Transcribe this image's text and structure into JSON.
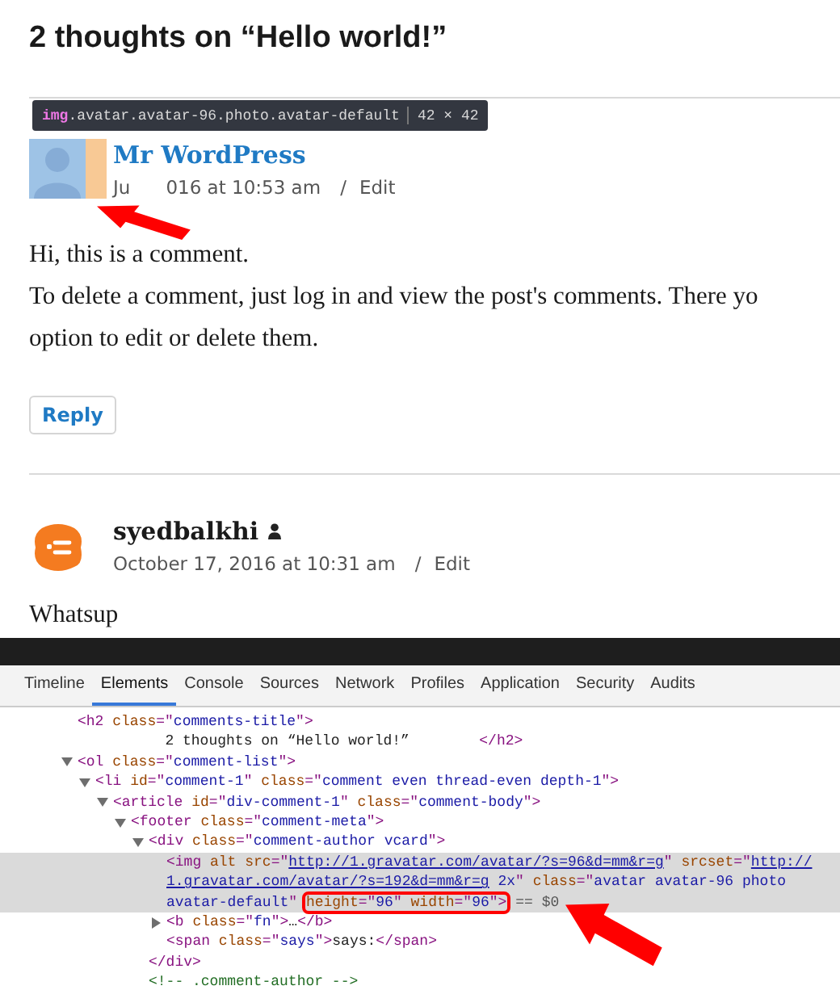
{
  "heading": "2 thoughts on “Hello world!”",
  "inspector_tooltip": {
    "tag": "img",
    "classes": ".avatar.avatar-96.photo.avatar-default",
    "size": "42 × 42"
  },
  "comments": [
    {
      "author": "Mr WordPress",
      "post_author": false,
      "avatar": {
        "kind": "default"
      },
      "date_parts": [
        "Ju",
        "016 at 10:53 am"
      ],
      "separator": "/",
      "edit": "Edit",
      "body": [
        "Hi, this is a comment.",
        "To delete a comment, just log in and view the post's comments. There yo",
        "option to edit or delete them."
      ],
      "reply": "Reply",
      "annotated": true
    },
    {
      "author": "syedbalkhi",
      "post_author": true,
      "avatar": {
        "kind": "logo"
      },
      "date_parts": [
        "October 17, 2016 at 10:31 am"
      ],
      "separator": "/",
      "edit": "Edit",
      "body": [
        "Whatsup"
      ],
      "annotated": false
    }
  ],
  "devtools": {
    "tabs": [
      {
        "label": "Timeline",
        "selected": false
      },
      {
        "label": "Elements",
        "selected": true
      },
      {
        "label": "Console",
        "selected": false
      },
      {
        "label": "Sources",
        "selected": false
      },
      {
        "label": "Network",
        "selected": false
      },
      {
        "label": "Profiles",
        "selected": false
      },
      {
        "label": "Application",
        "selected": false
      },
      {
        "label": "Security",
        "selected": false
      },
      {
        "label": "Audits",
        "selected": false
      }
    ],
    "nodes": [
      {
        "selected": false,
        "lines": [
          [
            {
              "kind": "tag",
              "text": "<h2"
            },
            {
              "kind": "attr",
              "text": " class"
            },
            {
              "kind": "tag",
              "text": "=\""
            },
            {
              "kind": "value",
              "text": "comments-title"
            },
            {
              "kind": "tag",
              "text": "\">"
            }
          ]
        ],
        "children": [
          {
            "selected": false,
            "lines": [
              [
                {
                  "kind": "plain",
                  "text": "        2 thoughts on “Hello world!”        "
                },
                {
                  "kind": "tag",
                  "text": "</h2>"
                }
              ]
            ]
          }
        ]
      },
      {
        "selected": false,
        "expanded": true,
        "lines": [
          [
            {
              "kind": "tag",
              "text": "<ol"
            },
            {
              "kind": "attr",
              "text": " class"
            },
            {
              "kind": "tag",
              "text": "=\""
            },
            {
              "kind": "value",
              "text": "comment-list"
            },
            {
              "kind": "tag",
              "text": "\">"
            }
          ]
        ],
        "children": [
          {
            "selected": false,
            "expanded": true,
            "lines": [
              [
                {
                  "kind": "tag",
                  "text": "<li"
                },
                {
                  "kind": "attr",
                  "text": " id"
                },
                {
                  "kind": "tag",
                  "text": "=\""
                },
                {
                  "kind": "value",
                  "text": "comment-1"
                },
                {
                  "kind": "tag",
                  "text": "\""
                },
                {
                  "kind": "attr",
                  "text": " class"
                },
                {
                  "kind": "tag",
                  "text": "=\""
                },
                {
                  "kind": "value",
                  "text": "comment even thread-even depth-1"
                },
                {
                  "kind": "tag",
                  "text": "\">"
                }
              ]
            ],
            "children": [
              {
                "selected": false,
                "expanded": true,
                "lines": [
                  [
                    {
                      "kind": "tag",
                      "text": "<article"
                    },
                    {
                      "kind": "attr",
                      "text": " id"
                    },
                    {
                      "kind": "tag",
                      "text": "=\""
                    },
                    {
                      "kind": "value",
                      "text": "div-comment-1"
                    },
                    {
                      "kind": "tag",
                      "text": "\""
                    },
                    {
                      "kind": "attr",
                      "text": " class"
                    },
                    {
                      "kind": "tag",
                      "text": "=\""
                    },
                    {
                      "kind": "value",
                      "text": "comment-body"
                    },
                    {
                      "kind": "tag",
                      "text": "\">"
                    }
                  ]
                ],
                "children": [
                  {
                    "selected": false,
                    "expanded": true,
                    "lines": [
                      [
                        {
                          "kind": "tag",
                          "text": "<footer"
                        },
                        {
                          "kind": "attr",
                          "text": " class"
                        },
                        {
                          "kind": "tag",
                          "text": "=\""
                        },
                        {
                          "kind": "value",
                          "text": "comment-meta"
                        },
                        {
                          "kind": "tag",
                          "text": "\">"
                        }
                      ]
                    ],
                    "children": [
                      {
                        "selected": false,
                        "expanded": true,
                        "lines": [
                          [
                            {
                              "kind": "tag",
                              "text": "<div"
                            },
                            {
                              "kind": "attr",
                              "text": " class"
                            },
                            {
                              "kind": "tag",
                              "text": "=\""
                            },
                            {
                              "kind": "value",
                              "text": "comment-author vcard"
                            },
                            {
                              "kind": "tag",
                              "text": "\">"
                            }
                          ]
                        ],
                        "close": [
                          {
                            "kind": "tag",
                            "text": "</div>"
                          }
                        ],
                        "children": [
                          {
                            "selected": true,
                            "lines": [
                              [
                                {
                                  "kind": "tag",
                                  "text": "<img"
                                },
                                {
                                  "kind": "attr",
                                  "text": " alt src"
                                },
                                {
                                  "kind": "tag",
                                  "text": "=\""
                                },
                                {
                                  "kind": "link",
                                  "text": "http://1.gravatar.com/avatar/?s=96&d=mm&r=g"
                                },
                                {
                                  "kind": "tag",
                                  "text": "\""
                                },
                                {
                                  "kind": "attr",
                                  "text": " srcset"
                                },
                                {
                                  "kind": "tag",
                                  "text": "=\""
                                },
                                {
                                  "kind": "link",
                                  "text": "http://"
                                }
                              ],
                              [
                                {
                                  "kind": "link",
                                  "text": "1.gravatar.com/avatar/?s=192&d=mm&r=g"
                                },
                                {
                                  "kind": "value",
                                  "text": " 2x"
                                },
                                {
                                  "kind": "tag",
                                  "text": "\""
                                },
                                {
                                  "kind": "attr",
                                  "text": " class"
                                },
                                {
                                  "kind": "tag",
                                  "text": "=\""
                                },
                                {
                                  "kind": "value",
                                  "text": "avatar avatar-96 photo"
                                }
                              ],
                              [
                                {
                                  "kind": "value",
                                  "text": "avatar-default"
                                },
                                {
                                  "kind": "tag",
                                  "text": "\" "
                                },
                                {
                                  "kind": "box",
                                  "tokens": [
                                    {
                                      "kind": "attr",
                                      "text": "height"
                                    },
                                    {
                                      "kind": "tag",
                                      "text": "=\""
                                    },
                                    {
                                      "kind": "value",
                                      "text": "96"
                                    },
                                    {
                                      "kind": "tag",
                                      "text": "\""
                                    },
                                    {
                                      "kind": "attr",
                                      "text": " width"
                                    },
                                    {
                                      "kind": "tag",
                                      "text": "=\""
                                    },
                                    {
                                      "kind": "value",
                                      "text": "96"
                                    },
                                    {
                                      "kind": "tag",
                                      "text": "\">"
                                    }
                                  ]
                                },
                                {
                                  "kind": "meta",
                                  "text": " == $0"
                                }
                              ]
                            ]
                          },
                          {
                            "selected": false,
                            "expanded": false,
                            "lines": [
                              [
                                {
                                  "kind": "tag",
                                  "text": "<b"
                                },
                                {
                                  "kind": "attr",
                                  "text": " class"
                                },
                                {
                                  "kind": "tag",
                                  "text": "=\""
                                },
                                {
                                  "kind": "value",
                                  "text": "fn"
                                },
                                {
                                  "kind": "tag",
                                  "text": "\">"
                                },
                                {
                                  "kind": "plain",
                                  "text": "…"
                                },
                                {
                                  "kind": "tag",
                                  "text": "</b>"
                                }
                              ]
                            ]
                          },
                          {
                            "selected": false,
                            "lines": [
                              [
                                {
                                  "kind": "tag",
                                  "text": "<span"
                                },
                                {
                                  "kind": "attr",
                                  "text": " class"
                                },
                                {
                                  "kind": "tag",
                                  "text": "=\""
                                },
                                {
                                  "kind": "value",
                                  "text": "says"
                                },
                                {
                                  "kind": "tag",
                                  "text": "\">"
                                },
                                {
                                  "kind": "plain",
                                  "text": "says:"
                                },
                                {
                                  "kind": "tag",
                                  "text": "</span>"
                                }
                              ]
                            ]
                          }
                        ]
                      },
                      {
                        "selected": false,
                        "lines": [
                          [
                            {
                              "kind": "comment",
                              "text": "<!-- .comment-author -->"
                            }
                          ]
                        ]
                      }
                    ]
                  }
                ]
              }
            ]
          }
        ]
      }
    ]
  }
}
